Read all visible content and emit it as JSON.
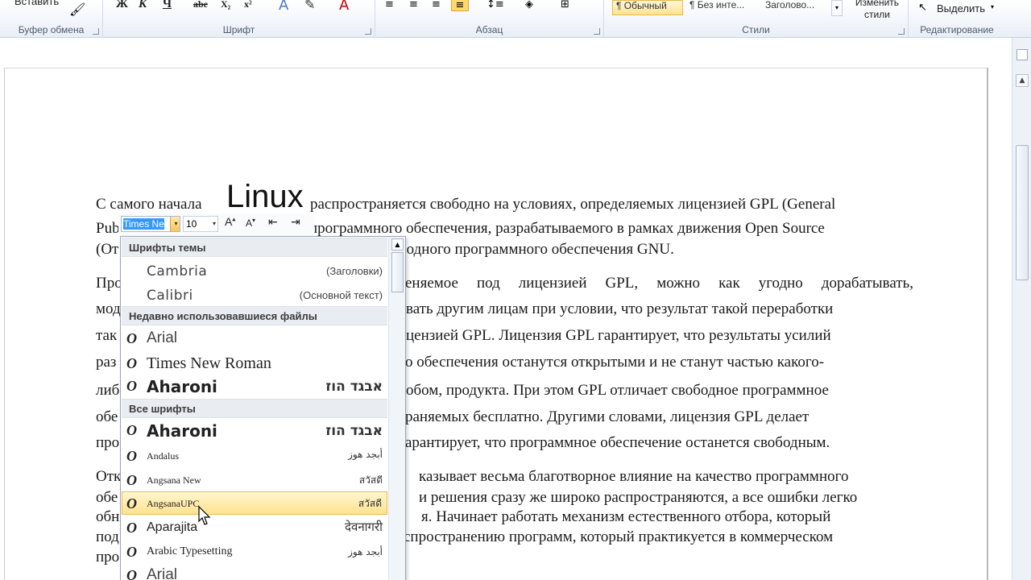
{
  "ribbon": {
    "paste_label": "Вставить",
    "groups": {
      "clipboard": "Буфер обмена",
      "font": "Шрифт",
      "paragraph": "Абзац",
      "styles": "Стили",
      "editing": "Редактирование"
    },
    "format_buttons": [
      "Ж",
      "К",
      "Ч",
      "abe",
      "X₂",
      "x²"
    ],
    "styles_gallery": [
      "¶ Обычный",
      "¶ Без инте...",
      "Заголово..."
    ],
    "change_styles_label": "Изменить стили",
    "select_label": "Выделить"
  },
  "document": {
    "highlight_word": "Linux",
    "paragraph1": [
      "С самого начала",
      "распространяется свободно на условиях, определяемых лицензией GPL (General",
      "Pub",
      "программного обеспечения, разрабатываемого в рамках движения Open Source",
      "(От",
      "бодного программного обеспечения GNU."
    ],
    "paragraph2": [
      [
        "Про",
        "еняемое под лицензией GPL, можно как угодно дорабатывать,"
      ],
      [
        "мод",
        "вать другим лицам при условии, что результат такой переработки"
      ],
      [
        "так",
        "цензией GPL. Лицензия GPL гарантирует, что результаты усилий"
      ],
      [
        "раз",
        "о обеспечения останутся открытыми и не станут частью какого-"
      ],
      [
        "либ",
        "обом, продукта. При этом GPL отличает свободное программное"
      ],
      [
        "обе",
        "раняемых бесплатно. Другими словами, лицензия GPL делает"
      ],
      [
        "про",
        "арантирует, что программное обеспечение останется свободным."
      ]
    ],
    "paragraph3": [
      [
        "Отк",
        "казывает весьма благотворное влияние на качество программного"
      ],
      [
        "обе",
        "и решения сразу же широко распространяются, а все ошибки легко"
      ],
      [
        "обн",
        "я. Начинает работать механизм естественного отбора, который"
      ],
      [
        "под",
        "спространению программ, который практикуется в коммерческом"
      ],
      [
        "про",
        ""
      ]
    ]
  },
  "mini_toolbar": {
    "font_value": "Times Ne",
    "size_value": "10"
  },
  "font_dropdown": {
    "theme_header": "Шрифты темы",
    "theme_fonts": [
      {
        "name": "Cambria",
        "role": "(Заголовки)"
      },
      {
        "name": "Calibri",
        "role": "(Основной текст)"
      }
    ],
    "recent_header": "Недавно использовавшиеся файлы",
    "recent_fonts": [
      {
        "name": "Arial",
        "sample": ""
      },
      {
        "name": "Times New Roman",
        "sample": ""
      },
      {
        "name": "Aharoni",
        "sample": "אבגד הוז"
      }
    ],
    "all_header": "Все шрифты",
    "all_fonts": [
      {
        "name": "Aharoni",
        "sample": "אבגד הוז"
      },
      {
        "name": "Andalus",
        "sample": "أبجد هوز"
      },
      {
        "name": "Angsana New",
        "sample": "สวัสดี"
      },
      {
        "name": "AngsanaUPC",
        "sample": "สวัสดี"
      },
      {
        "name": "Aparajita",
        "sample": "देवनागरी"
      },
      {
        "name": "Arabic Typesetting",
        "sample": "أبجد هوز"
      },
      {
        "name": "Arial",
        "sample": ""
      }
    ],
    "highlighted_font": "AngsanaUPC"
  }
}
